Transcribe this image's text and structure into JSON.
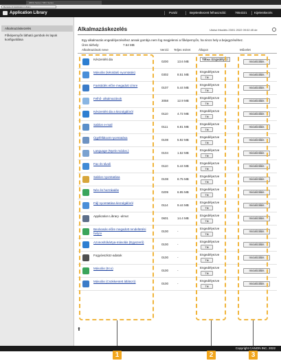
{
  "browser": {
    "tab_title": "[MFC] Series / MFC Series",
    "url": "Remote UI Application Library"
  },
  "header": {
    "app_title": "Application Library",
    "links": [
      "Portál",
      "Bejelentkezett felhasználó:",
      "7654321",
      "Kijelentkezés"
    ]
  },
  "sidebar": {
    "items": [
      {
        "label": "Alkalmazáskezelés",
        "active": true
      },
      {
        "label": "Főképernyőn látható gombok és lapok konfigurálása",
        "active": false
      }
    ]
  },
  "main": {
    "title": "Alkalmazáskezelés",
    "updated": "Utolsó frissítés 23/01 2022 09:02:45 de",
    "description": "Egy alkalmazás engedélyezéséhez annak gombja nem fog megjelenni a főképernyőn, ha nincs hely a bejegyzéséhez.",
    "storage_label": "Üres tárhely:",
    "storage_value": "7.54 MB",
    "columns": {
      "name": "Alkalmazások neve",
      "version": "Verzió",
      "size": "Teljes méret",
      "state": "Állapot",
      "action": "Művelet"
    },
    "state_labels": {
      "enabled": "Engedélyezve",
      "off": "Tiltva",
      "enable": "Engedélyez"
    },
    "button_labels": {
      "disable": "Tilt",
      "init": "Inicializálás"
    },
    "rows": [
      {
        "name": "Készenléti dia",
        "version": "0200",
        "size": "13.6 MB",
        "icon_color": "#2e7fd1",
        "link": false
      },
      {
        "name": "Másolás (kétoldalú nyomtatás)",
        "version": "0302",
        "size": "8.51 MB",
        "icon_color": "#4a8fd8",
        "link": true
      },
      {
        "name": "Faxküldés előre megadott címre",
        "version": "0107",
        "size": "5.44 MB",
        "icon_color": "#3b7cc8",
        "link": true
      },
      {
        "name": "Felhő- alkalmazások",
        "version": "3058",
        "size": "12.9 MB",
        "icon_color": "#8ab6e3",
        "link": true
      },
      {
        "name": "Készenléti dia a kiszolgálóról",
        "version": "0110",
        "size": "4.72 MB",
        "icon_color": "#2e7fd1",
        "link": true
      },
      {
        "name": "Sablon e-mail",
        "version": "0111",
        "size": "6.81 MB",
        "icon_color": "#5b8fc9",
        "link": true
      },
      {
        "name": "Ügyféllátoott nyomtatása",
        "version": "0108",
        "size": "5.92 MB",
        "icon_color": "#6e93c2",
        "link": true
      },
      {
        "name": "Language (Nyelv módos.)",
        "version": "0104",
        "size": "1.52 MB",
        "icon_color": "#7aa2d0",
        "link": true
      },
      {
        "name": "Fax és távoli",
        "version": "0110",
        "size": "5.44 MB",
        "icon_color": "#3f8ad6",
        "link": true
      },
      {
        "name": "Sablon nyomtatása",
        "version": "0108",
        "size": "8.75 MB",
        "icon_color": "#d7a63a",
        "link": true
      },
      {
        "name": "Név és hozzáadás",
        "version": "0209",
        "size": "6.95 MB",
        "icon_color": "#3aa55a",
        "link": true
      },
      {
        "name": "Fájl nyomtatása kiszolgálóról",
        "version": "0114",
        "size": "9.44 MB",
        "icon_color": "#4a8fd8",
        "link": true
      },
      {
        "name": "Application Library -ulmut",
        "version": "0601",
        "size": "14.4 MB",
        "icon_color": "#5e6f89",
        "link": false
      },
      {
        "name": "Beolvasás előre megadott rendeltetési helyre",
        "version": "0100",
        "size": "-",
        "icon_color": "#3aa55a",
        "link": true
      },
      {
        "name": "Azonosítókártya-másolás (Egyszerű)",
        "version": "0100",
        "size": "-",
        "icon_color": "#2e7fd1",
        "link": true
      },
      {
        "name": "Fogyóeszköz-adatok",
        "version": "0100",
        "size": "-",
        "icon_color": "#4f4f4f",
        "link": false
      },
      {
        "name": "Másolás (Eco)",
        "version": "0100",
        "size": "-",
        "icon_color": "#3aa55a",
        "link": true
      },
      {
        "name": "Másolás (Csökkentett átlátszó)",
        "version": "0100",
        "size": "-",
        "icon_color": "#3b7cc8",
        "link": true
      }
    ]
  },
  "callouts": [
    "1",
    "2",
    "3"
  ],
  "footer": {
    "copyright": "Copyright CANON INC. 2022"
  }
}
